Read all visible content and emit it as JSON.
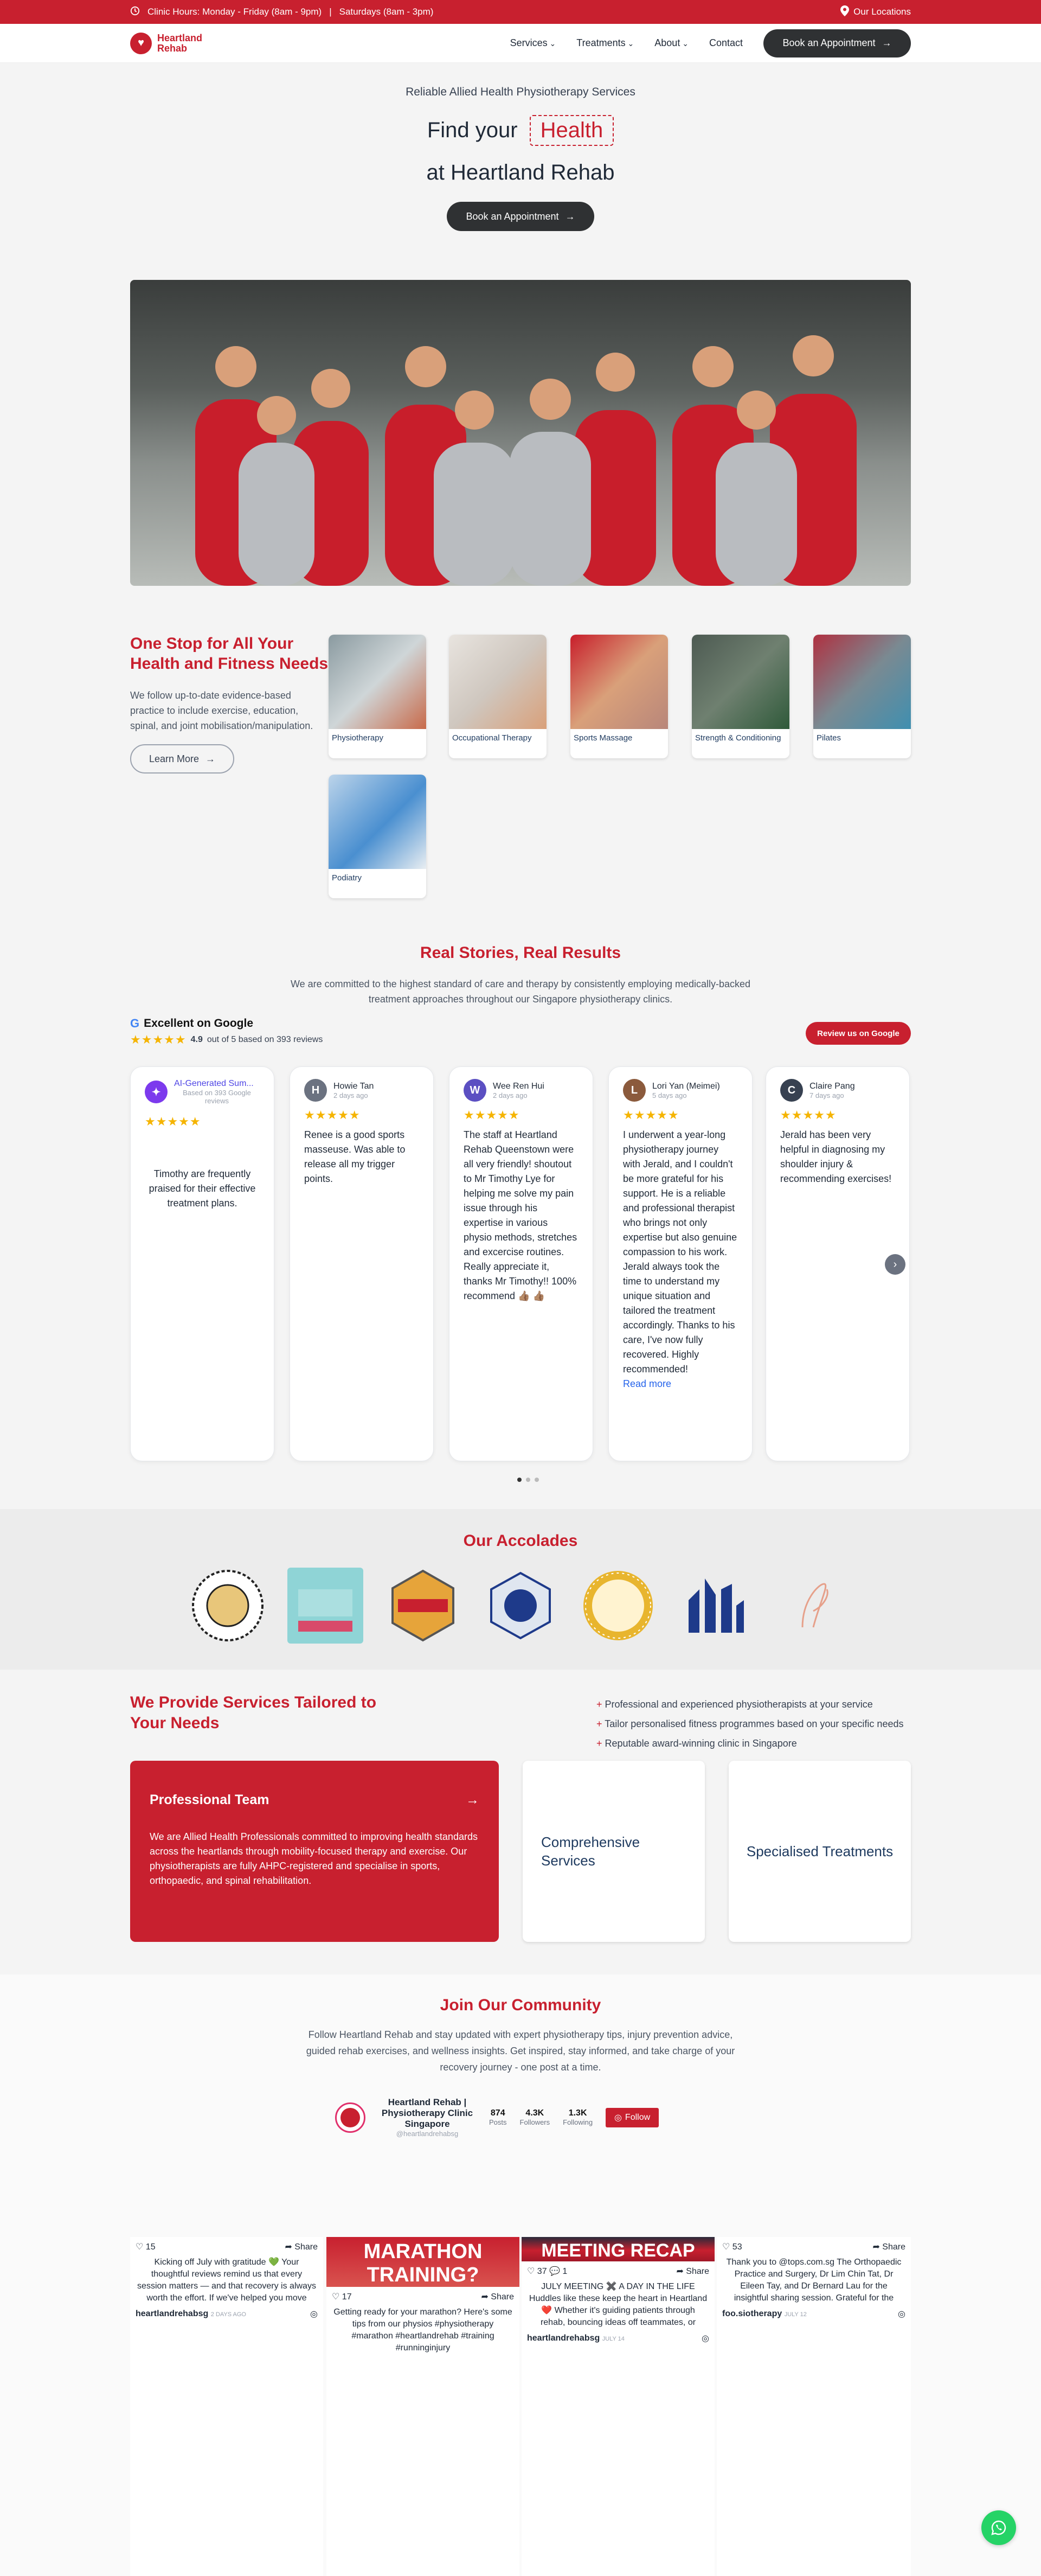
{
  "topbar": {
    "hours": "Clinic Hours: Monday - Friday (8am - 9pm)",
    "divider": "|",
    "weekend": "Saturdays (8am - 3pm)",
    "locations": "Our Locations"
  },
  "nav": {
    "logo_line1": "Heartland",
    "logo_line2": "Rehab",
    "items": [
      "Services",
      "Treatments",
      "About",
      "Contact"
    ],
    "cta": "Book an Appointment"
  },
  "hero": {
    "eyebrow": "Reliable Allied Health Physiotherapy Services",
    "title_pre": "Find your",
    "title_word": "Health",
    "title_post": "at Heartland Rehab",
    "cta": "Book an Appointment"
  },
  "one_stop": {
    "title": "One Stop for All Your Health and Fitness Needs",
    "body": "We follow up-to-date evidence-based practice to include exercise, education, spinal, and joint mobilisation/manipulation.",
    "cta": "Learn More",
    "services": [
      "Physiotherapy",
      "Occupational Therapy",
      "Sports Massage",
      "Strength & Conditioning",
      "Pilates",
      "Podiatry"
    ]
  },
  "reviews": {
    "title": "Real Stories, Real Results",
    "intro": "We are committed to the highest standard of care and therapy by consistently employing medically-backed treatment approaches throughout our Singapore physiotherapy clinics.",
    "google_label": "Excellent on Google",
    "rating": "4.9",
    "rating_suffix": "out of 5 based on 393 reviews",
    "review_btn": "Review us on Google",
    "ai_card": {
      "name": "AI-Generated Sum...",
      "sub": "Based on 393 Google reviews",
      "text": "Timothy are frequently praised for their effective treatment plans."
    },
    "items": [
      {
        "initial": "H",
        "name": "Howie Tan",
        "date": "2 days ago",
        "text": "Renee is a good sports masseuse. Was able to release all my trigger points.",
        "color": "#6b7280"
      },
      {
        "initial": "W",
        "name": "Wee Ren Hui",
        "date": "2 days ago",
        "text": "The staff at Heartland Rehab Queenstown were all very friendly! shoutout to Mr Timothy Lye for helping me solve my pain issue through his expertise in various physio methods, stretches and excercise routines. Really appreciate it, thanks Mr Timothy!! 100% recommend 👍🏽 👍🏽",
        "color": "#5b4fc2"
      },
      {
        "initial": "L",
        "name": "Lori Yan (Meimei)",
        "date": "5 days ago",
        "text": "I underwent a year-long physiotherapy journey with Jerald, and I couldn't be more grateful for his support. He is a reliable and professional therapist who brings not only expertise but also genuine compassion to his work. Jerald always took the time to understand my unique situation and tailored the treatment accordingly. Thanks to his care, I've now fully recovered. Highly recommended!",
        "color": "#8b5a3c",
        "more": "Read more"
      },
      {
        "initial": "C",
        "name": "Claire Pang",
        "date": "7 days ago",
        "text": "Jerald has been very helpful in diagnosing my shoulder injury & recommending exercises!",
        "color": "#374151"
      }
    ]
  },
  "accolades": {
    "title": "Our Accolades",
    "items": [
      "Best in Singapore",
      "Readers' Choice",
      "Best in Singapore badge",
      "Singapore Business Review",
      "Top 3 Physiotherapy",
      "Smart Singapore",
      "Michelin Guide"
    ]
  },
  "tailored": {
    "title": "We Provide Services Tailored to Your Needs",
    "points": [
      "Professional and experienced physiotherapists at your service",
      "Tailor personalised fitness programmes based on your specific needs",
      "Reputable award-winning clinic in Singapore"
    ],
    "card1_title": "Professional Team",
    "card1_body": "We are Allied Health Professionals committed to improving health standards across the heartlands through mobility-focused therapy and exercise. Our physiotherapists are fully AHPC-registered and specialise in sports, orthopaedic, and spinal rehabilitation.",
    "card2_title": "Comprehensive Services",
    "card3_title": "Specialised Treatments"
  },
  "community": {
    "title": "Join Our Community",
    "body": "Follow Heartland Rehab and stay updated with expert physiotherapy tips, injury prevention advice, guided rehab exercises, and wellness insights. Get inspired, stay informed, and take charge of your recovery journey - one post at a time.",
    "profile_name": "Heartland Rehab | Physiotherapy Clinic Singapore",
    "handle": "@heartlandrehabsg",
    "posts": "874",
    "posts_label": "Posts",
    "followers": "4.3K",
    "followers_label": "Followers",
    "following": "1.3K",
    "following_label": "Following",
    "follow_btn": "Follow"
  },
  "ig": [
    {
      "likes": "15",
      "comments": "",
      "share": "Share",
      "caption": "Kicking off July with gratitude 💚 Your thoughtful reviews remind us that every session matters — and that recovery is always worth the effort. If we've helped you move better or feel stronger, let us know with a",
      "user": "heartlandrehabsg",
      "date": "2 DAYS AGO",
      "overlay": ""
    },
    {
      "likes": "17",
      "comments": "",
      "share": "Share",
      "caption": "Getting ready for your marathon? Here's some tips from our physios #physiotherapy #marathon #heartlandrehab #training #runninginjury",
      "user": "",
      "date": "",
      "overlay": "MARATHON TRAINING?"
    },
    {
      "likes": "37",
      "comments": "1",
      "share": "Share",
      "caption": "JULY MEETING ✖️ A DAY IN THE LIFE Huddles like these keep the heart in Heartland ❤️ Whether it's guiding patients through rehab, bouncing ideas off teammates, or squeezing in a much-needed coffee break, this is what a day",
      "user": "heartlandrehabsg",
      "date": "JULY 14",
      "overlay": "MEETING RECAP"
    },
    {
      "likes": "53",
      "comments": "",
      "share": "Share",
      "caption": "Thank you to @tops.com.sg The Orthopaedic Practice and Surgery, Dr Lim Chin Tat, Dr Eileen Tay, and Dr Bernard Lau for the insightful sharing session. Grateful for the opportunity to learn and grow together. Looking",
      "user": "foo.siotherapy",
      "date": "JULY 12",
      "overlay": ""
    }
  ]
}
